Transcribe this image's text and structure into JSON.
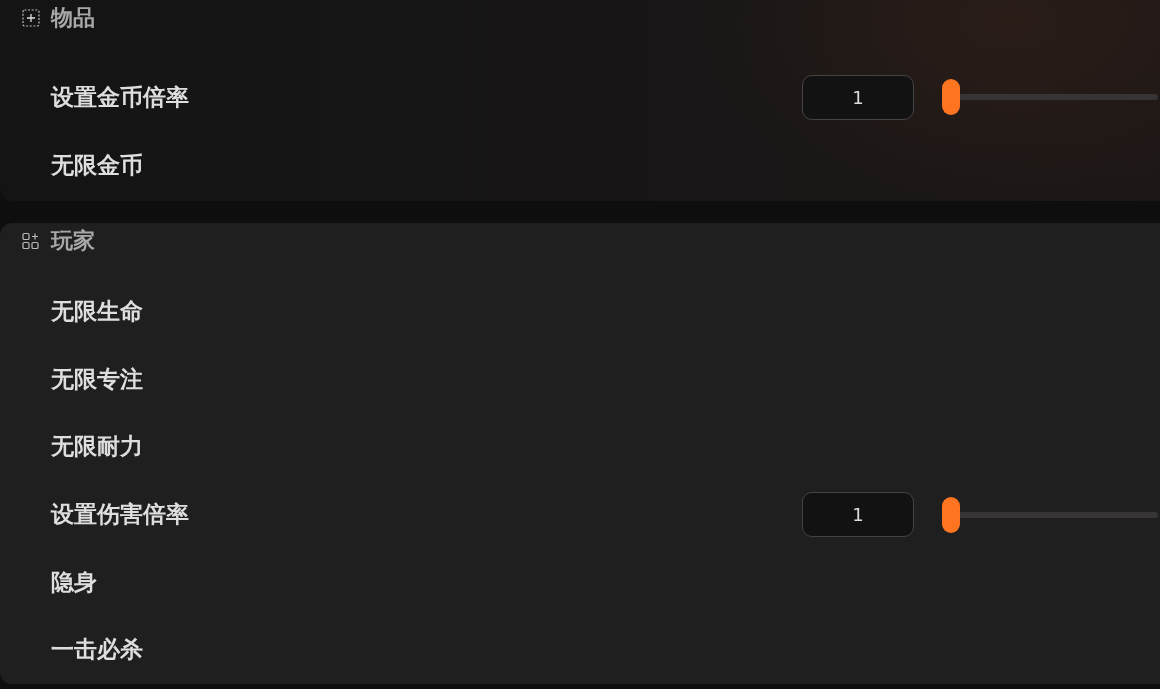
{
  "sections": [
    {
      "title": "物品",
      "items": [
        {
          "label": "设置金币倍率",
          "kind": "slider",
          "value": "1",
          "level": 0
        },
        {
          "label": "无限金币",
          "kind": "option"
        }
      ]
    },
    {
      "title": "玩家",
      "items": [
        {
          "label": "无限生命",
          "kind": "option"
        },
        {
          "label": "无限专注",
          "kind": "option"
        },
        {
          "label": "无限耐力",
          "kind": "option"
        },
        {
          "label": "设置伤害倍率",
          "kind": "slider",
          "value": "1",
          "level": 0
        },
        {
          "label": "隐身",
          "kind": "option"
        },
        {
          "label": "一击必杀",
          "kind": "option"
        }
      ]
    }
  ]
}
